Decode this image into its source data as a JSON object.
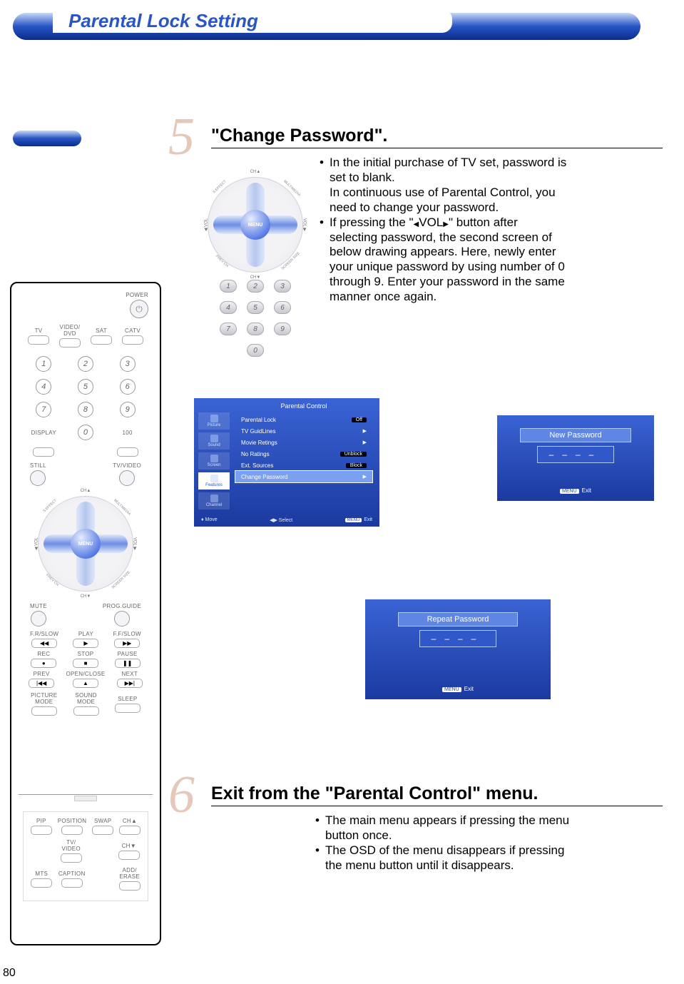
{
  "page": {
    "title": "Parental Lock Setting",
    "number": "80"
  },
  "step5": {
    "num": "5",
    "title": "\"Change Password\".",
    "bullets": {
      "b1": {
        "line1": "In the initial purchase of TV set, password is",
        "line2": "set to blank.",
        "line3": "In continuous use of Parental Control, you",
        "line4": "need to change your password."
      },
      "b2": {
        "line1": "If pressing the \"",
        "mid": "VOL",
        "line1b": "\" button after",
        "line2": "selecting password, the second screen of",
        "line3": "below drawing appears. Here, newly enter",
        "line4": "your unique password by using number of 0",
        "line5": "through 9. Enter your password in the same",
        "line6": "manner once again."
      }
    },
    "dpad": {
      "center": "MENU",
      "chUp": "CH▲",
      "chDown": "CH▼",
      "volLeft": "VOL",
      "volRight": "VOL",
      "multimedia": "MULTIMEDIA",
      "seffect": "S.EFFECT",
      "prevch": "PREV CH",
      "screensize": "SCREEN SIZE"
    },
    "numpad": [
      "1",
      "2",
      "3",
      "4",
      "5",
      "6",
      "7",
      "8",
      "9",
      "0"
    ]
  },
  "osd": {
    "title": "Parental Control",
    "side": {
      "picture": "Picture",
      "sound": "Sound",
      "screen": "Screen",
      "features": "Features",
      "channel": "Channel"
    },
    "rows": {
      "parentalLock": {
        "label": "Parental Lock",
        "value": "Off"
      },
      "tvGuidlines": {
        "label": "TV GuidLines"
      },
      "movieRatings": {
        "label": "Movie Retings"
      },
      "noRatings": {
        "label": "No Ratings",
        "value": "Unblock"
      },
      "extSources": {
        "label": "Ext. Sources",
        "value": "Block"
      },
      "changePassword": {
        "label": "Change Password"
      }
    },
    "footer": {
      "move": "Move",
      "select": "Select",
      "menu": "MENU",
      "exit": "Exit"
    }
  },
  "pwNew": {
    "title": "New Password",
    "slots": "––––",
    "menu": "MENU",
    "exit": "Exit"
  },
  "pwRepeat": {
    "title": "Repeat Password",
    "slots": "––––",
    "menu": "MENU",
    "exit": "Exit"
  },
  "step6": {
    "num": "6",
    "title": "Exit from the \"Parental Control\" menu.",
    "bullets": {
      "b1": {
        "line1": "The main menu appears if pressing the menu",
        "line2": "button once."
      },
      "b2": {
        "line1": "The OSD of the menu disappears if pressing",
        "line2": "the menu button until it disappears."
      }
    }
  },
  "remote": {
    "power": "POWER",
    "topRow": {
      "tv": "TV",
      "videoDvd": "VIDEO/\nDVD",
      "sat": "SAT",
      "catv": "CATV"
    },
    "numbers": [
      "1",
      "2",
      "3",
      "4",
      "5",
      "6",
      "7",
      "8",
      "9",
      "0"
    ],
    "display": "DISPLAY",
    "hundred": "100",
    "still": "STILL",
    "tvvideo": "TV/VIDEO",
    "dpad": {
      "center": "MENU",
      "chUp": "CH▲",
      "chDown": "CH▼",
      "volLeft": "VOL",
      "volRight": "VOL",
      "multimedia": "MULTIMEDIA",
      "seffect": "S.EFFECT",
      "prevch": "PREV CH",
      "screensize": "SCREEN SIZE"
    },
    "mute": "MUTE",
    "progGuide": "PROG.GUIDE",
    "frslow": "F.R/SLOW",
    "play": "PLAY",
    "ffslow": "F.F/SLOW",
    "rec": "REC",
    "stop": "STOP",
    "pause": "PAUSE",
    "prev": "PREV",
    "openclose": "OPEN/CLOSE",
    "next": "NEXT",
    "picMode": "PICTURE\nMODE",
    "soundMode": "SOUND\nMODE",
    "sleep": "SLEEP",
    "pip": "PIP",
    "position": "POSITION",
    "swap": "SWAP",
    "chUp": "CH▲",
    "tvvideo2": "TV/\nVIDEO",
    "chDown": "CH▼",
    "mts": "MTS",
    "caption": "CAPTION",
    "adderase": "ADD/\nERASE"
  }
}
